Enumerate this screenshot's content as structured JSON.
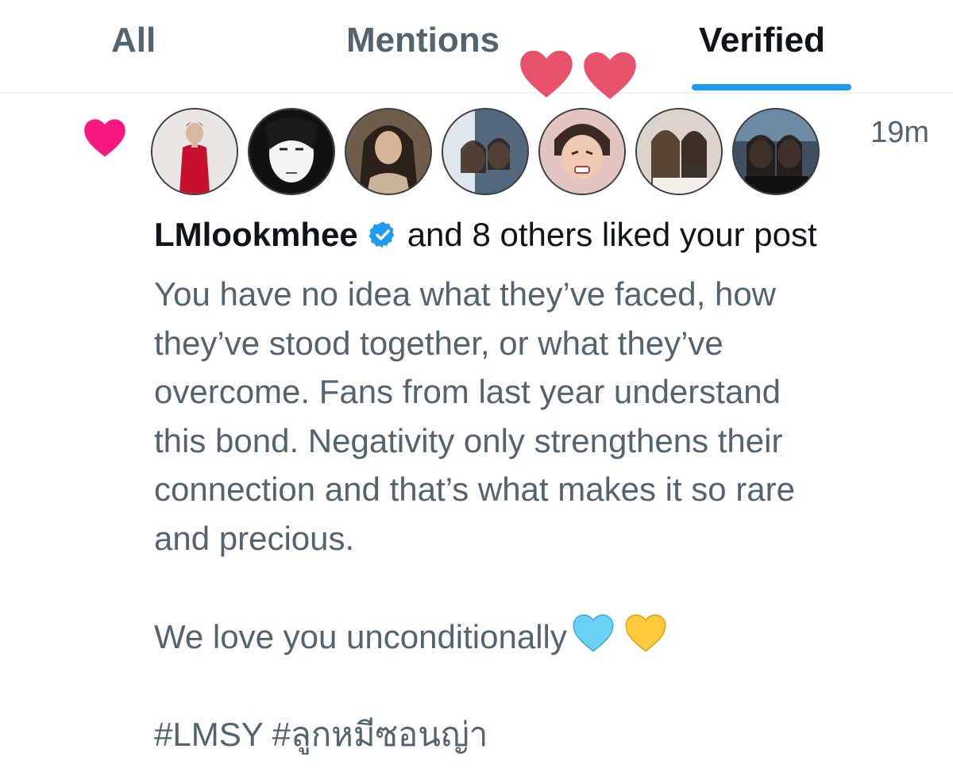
{
  "tabs": [
    {
      "label": "All"
    },
    {
      "label": "Mentions"
    },
    {
      "label": "Verified"
    }
  ],
  "active_tab": "Verified",
  "notification": {
    "type_icon": "heart-icon",
    "timestamp": "19m",
    "avatars": [
      {
        "name": "avatar-1"
      },
      {
        "name": "avatar-2"
      },
      {
        "name": "avatar-3"
      },
      {
        "name": "avatar-4"
      },
      {
        "name": "avatar-5"
      },
      {
        "name": "avatar-6"
      },
      {
        "name": "avatar-7"
      }
    ],
    "username": "LMlookmhee",
    "verified": true,
    "liked_text": "and 8 others liked your post",
    "post_text": "You have no idea what they’ve faced, how\nthey’ve stood together, or what they’ve\novercome. Fans from last year understand\nthis bond. Negativity only strengthens their\nconnection and that’s what makes it so rare\nand precious.\n\nWe love you unconditionally",
    "post_emojis": [
      "light-blue-heart-icon",
      "yellow-heart-icon"
    ],
    "hashtags": "#LMSY #ลูกหมีซอนญ่า"
  },
  "colors": {
    "accent": "#1d9bf0",
    "like_heart": "#f91880",
    "deco_heart": "#e8536b",
    "text_primary": "#0f1419",
    "text_secondary": "#536471"
  }
}
